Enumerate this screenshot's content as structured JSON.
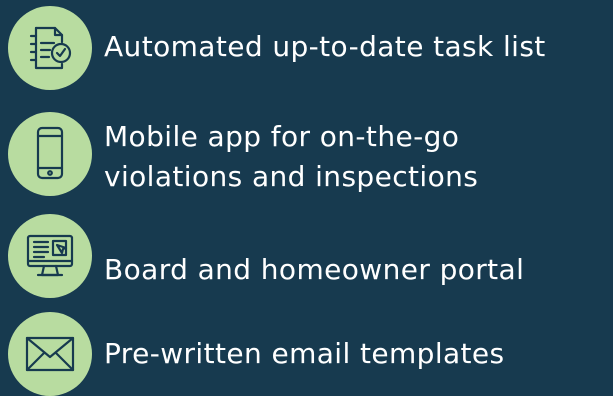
{
  "colors": {
    "background": "#173a4f",
    "icon_circle": "#b8dca0",
    "icon_stroke": "#173a4f",
    "text": "#ffffff"
  },
  "features": [
    {
      "icon": "task-list-icon",
      "lines": [
        "Automated up-to-date task list"
      ]
    },
    {
      "icon": "mobile-phone-icon",
      "lines": [
        "Mobile app for on-the-go",
        "violations and inspections"
      ]
    },
    {
      "icon": "computer-monitor-icon",
      "lines": [
        "Board and homeowner portal"
      ]
    },
    {
      "icon": "envelope-icon",
      "lines": [
        "Pre-written email templates"
      ]
    }
  ]
}
